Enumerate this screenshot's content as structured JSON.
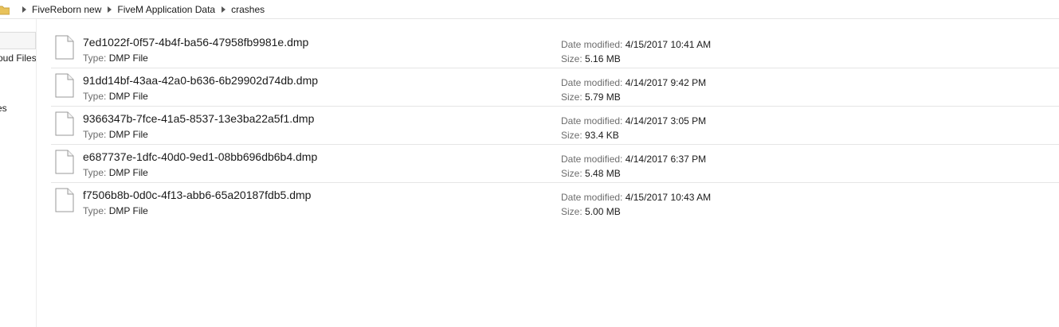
{
  "address_bar": {
    "breadcrumbs": [
      "FiveReborn new",
      "FiveM Application Data",
      "crashes"
    ],
    "folder_icon": "folder-icon",
    "separator_icon": "chevron-right-icon"
  },
  "sidebar": {
    "items": [
      {
        "label": "oud Files"
      },
      {
        "label": "es"
      }
    ]
  },
  "files": [
    {
      "name": "7ed1022f-0f57-4b4f-ba56-47958fb9981e.dmp",
      "type_label": "Type:",
      "type": "DMP File",
      "date_label": "Date modified:",
      "date": "4/15/2017 10:41 AM",
      "size_label": "Size:",
      "size": "5.16 MB"
    },
    {
      "name": "91dd14bf-43aa-42a0-b636-6b29902d74db.dmp",
      "type_label": "Type:",
      "type": "DMP File",
      "date_label": "Date modified:",
      "date": "4/14/2017 9:42 PM",
      "size_label": "Size:",
      "size": "5.79 MB"
    },
    {
      "name": "9366347b-7fce-41a5-8537-13e3ba22a5f1.dmp",
      "type_label": "Type:",
      "type": "DMP File",
      "date_label": "Date modified:",
      "date": "4/14/2017 3:05 PM",
      "size_label": "Size:",
      "size": "93.4 KB"
    },
    {
      "name": "e687737e-1dfc-40d0-9ed1-08bb696db6b4.dmp",
      "type_label": "Type:",
      "type": "DMP File",
      "date_label": "Date modified:",
      "date": "4/14/2017 6:37 PM",
      "size_label": "Size:",
      "size": "5.48 MB"
    },
    {
      "name": "f7506b8b-0d0c-4f13-abb6-65a20187fdb5.dmp",
      "type_label": "Type:",
      "type": "DMP File",
      "date_label": "Date modified:",
      "date": "4/15/2017 10:43 AM",
      "size_label": "Size:",
      "size": "5.00 MB"
    }
  ],
  "colors": {
    "folder": "#e8c25a",
    "meta_key": "#6d6d6d",
    "divider": "#e5e5e5"
  }
}
